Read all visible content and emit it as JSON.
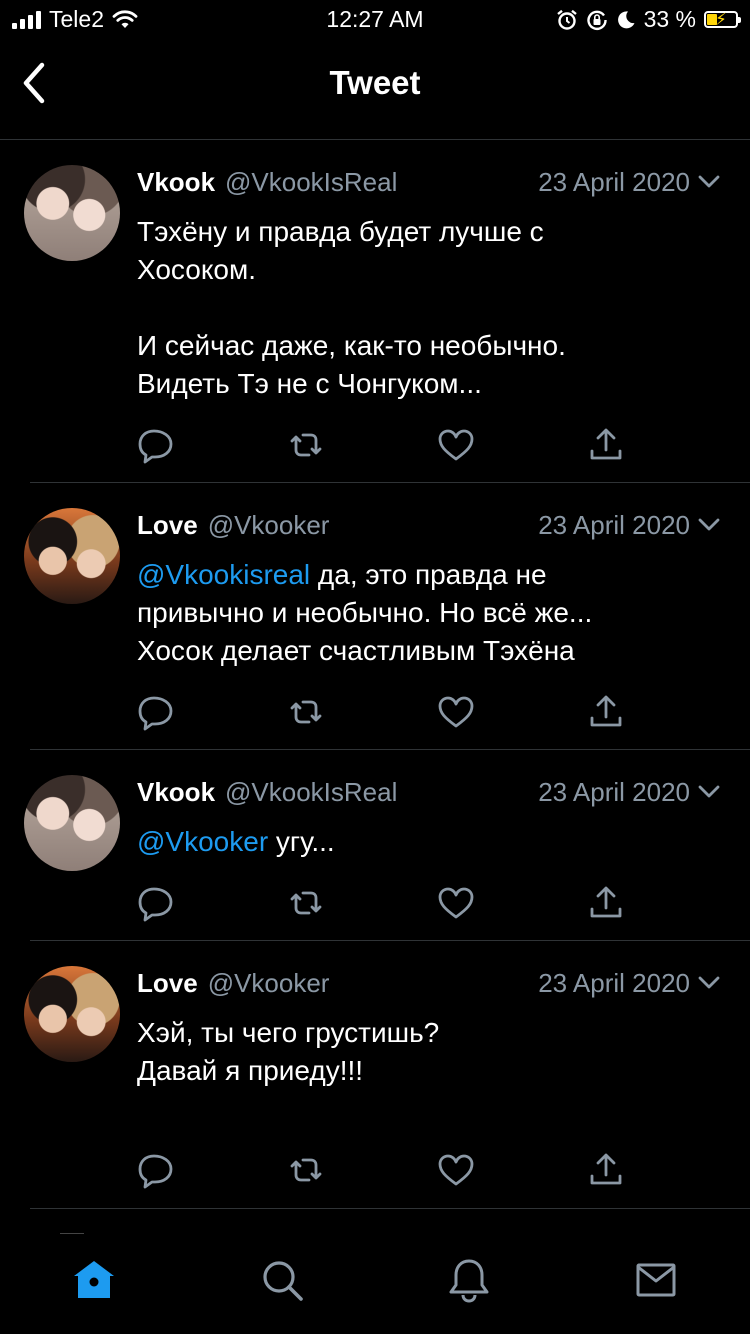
{
  "status_bar": {
    "carrier": "Tele2",
    "time": "12:27 AM",
    "battery_percent": "33 %",
    "battery_level": 0.33,
    "battery_color": "#ffd60a"
  },
  "header": {
    "title": "Tweet",
    "back_icon": "chevron-left-icon"
  },
  "colors": {
    "background": "#000000",
    "text": "#ffffff",
    "secondary_text": "#8b98a5",
    "link": "#1d9bf0",
    "divider": "#2f3336",
    "active_tab": "#1d9bf0"
  },
  "tweets": [
    {
      "name": "Vkook",
      "handle": "@VkookIsReal",
      "date": "23 April 2020",
      "mention": "",
      "text": "Тэхёну и правда будет лучше с\nХосоком.\n\nИ сейчас даже, как-то необычно.\nВидеть Тэ не с Чонгуком..."
    },
    {
      "name": "Love",
      "handle": "@Vkooker",
      "date": "23 April 2020",
      "mention": "@Vkookisreal",
      "text": " да, это правда не\nпривычно и необычно. Но всё же...\nХосок делает счастливым Тэхёна"
    },
    {
      "name": "Vkook",
      "handle": "@VkookIsReal",
      "date": "23 April 2020",
      "mention": "@Vkooker",
      "text": " угу..."
    },
    {
      "name": "Love",
      "handle": "@Vkooker",
      "date": "23 April 2020",
      "mention": "",
      "text": "Хэй, ты чего грустишь?\nДавай я приеду!!!"
    }
  ],
  "tab_bar": {
    "tabs": [
      "home-icon",
      "search-icon",
      "notifications-icon",
      "messages-icon"
    ],
    "active": "home-icon"
  }
}
